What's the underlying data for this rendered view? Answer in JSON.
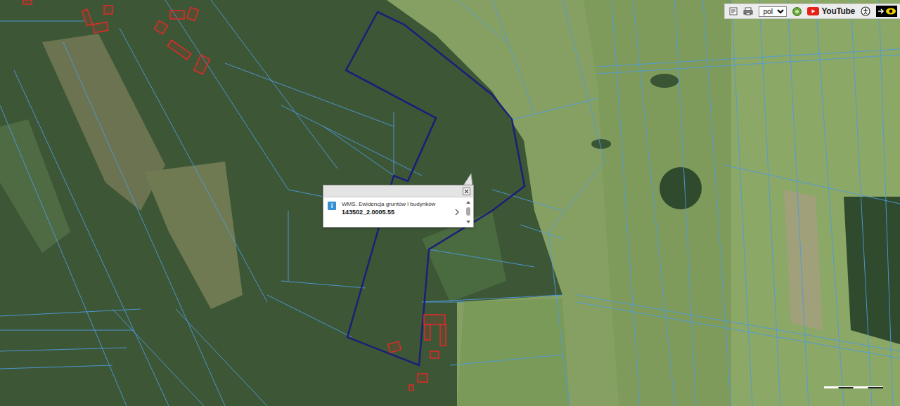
{
  "toolbar": {
    "language": "pol",
    "youtube": "YouTube"
  },
  "popup": {
    "info_icon": "i",
    "layer": "WMS. Ewidencja gruntów i budynków",
    "parcel_id": "143502_2.0005.55"
  }
}
